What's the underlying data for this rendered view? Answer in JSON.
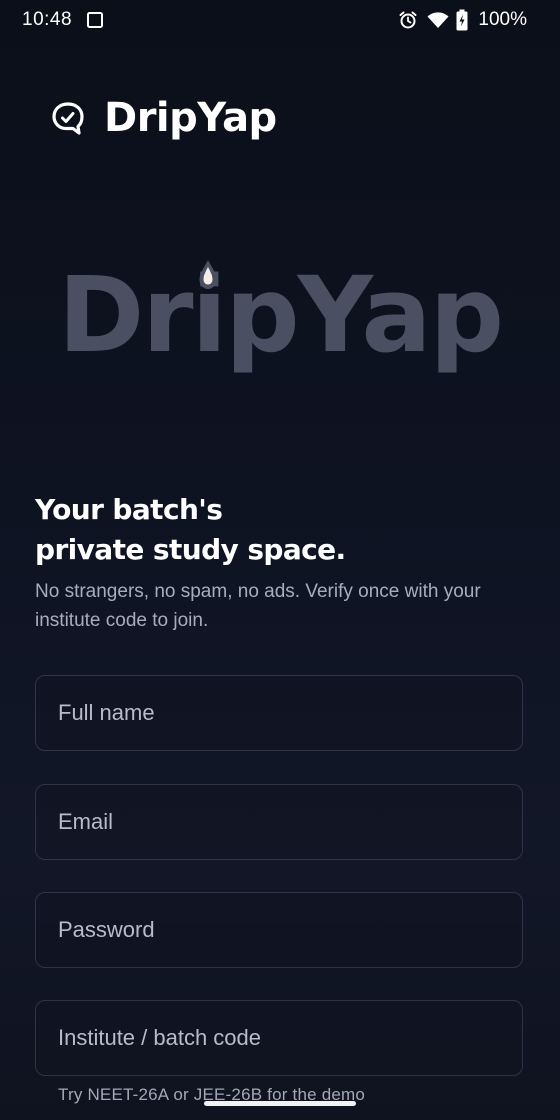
{
  "status_bar": {
    "time": "10:48",
    "battery": "100%",
    "icons": [
      "screenshot-icon",
      "alarm-icon",
      "wifi-icon",
      "battery-charging-icon"
    ]
  },
  "brand": {
    "name": "DripYap",
    "icon": "chat-bubble-logo-icon"
  },
  "hero": {
    "wordmark": "DripYap",
    "accent_icon": "droplet-icon",
    "color": "#4a4f61"
  },
  "headline": {
    "line1": "Your batch's",
    "line2": "private study space."
  },
  "subtext": "No strangers, no spam, no ads. Verify once with your institute code to join.",
  "form": {
    "fields": [
      {
        "placeholder": "Full name",
        "value": ""
      },
      {
        "placeholder": "Email",
        "value": ""
      },
      {
        "placeholder": "Password",
        "value": ""
      },
      {
        "placeholder": "Institute / batch code",
        "value": ""
      }
    ],
    "hint": "Try NEET-26A or JEE-26B for the demo"
  },
  "colors": {
    "background": "#0d1120",
    "field_border": "#2e3446",
    "muted_text": "#a8adbb",
    "hero_text": "#4a4f61"
  }
}
